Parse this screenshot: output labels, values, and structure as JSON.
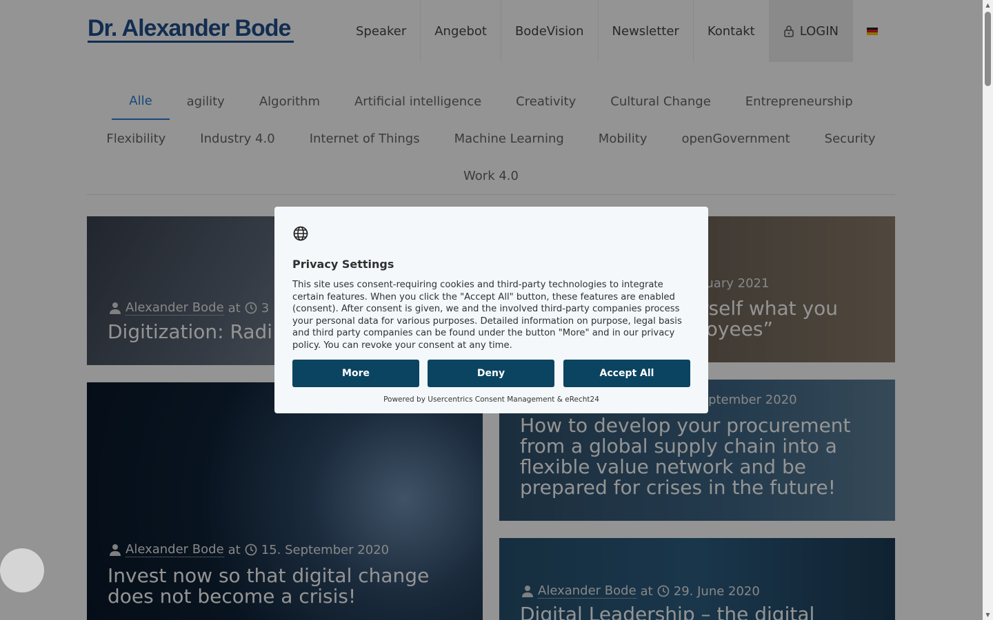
{
  "header": {
    "logo": "Dr. Alexander Bode",
    "nav": [
      "Speaker",
      "Angebot",
      "BodeVision",
      "Newsletter",
      "Kontakt"
    ],
    "login_label": "LOGIN",
    "language_flag": "de-flag-icon"
  },
  "categories": {
    "row1": [
      "Alle",
      "agility",
      "Algorithm",
      "Artificial intelligence",
      "Creativity",
      "Cultural Change",
      "Entrepreneurship"
    ],
    "row2": [
      "Flexibility",
      "Industry 4.0",
      "Internet of Things",
      "Machine Learning",
      "Mobility",
      "openGovernment",
      "Security"
    ],
    "row3": [
      "Work 4.0"
    ],
    "active": "Alle"
  },
  "posts": [
    {
      "author": "Alexander Bode",
      "at": "at",
      "date": "3",
      "title": "Digitization: Radi"
    },
    {
      "author": "",
      "at": "",
      "date": "ruary 2021",
      "title": "rself what you\nloyees”"
    },
    {
      "author": "Alexander Bode",
      "at": "at",
      "date": "15. September 2020",
      "title": "Invest now so that digital change does not become a crisis!"
    },
    {
      "author": "",
      "at": "",
      "date": "eptember 2020",
      "title": "How to develop your procurement from a global supply chain into a flexible value network and be prepared for crises in the future!"
    },
    {
      "author": "Alexander Bode",
      "at": "at",
      "date": "29. June 2020",
      "title": "Digital Leadership – the digital"
    }
  ],
  "privacy": {
    "title": "Privacy Settings",
    "text": "This site uses consent-requiring cookies and third-party technologies to integrate certain features. When you click the \"Accept All\" button, these features are enabled (consent). After consent is given, we and the involved third-party companies process your personal data for various purposes. Detailed information on purpose, legal basis and third party companies can be found under the button \"More\" and in our privacy policy. You can revoke your consent at any time.",
    "more_label": "More",
    "deny_label": "Deny",
    "accept_label": "Accept All",
    "powered_by": "Powered by Usercentrics Consent Management & eRecht24"
  },
  "colors": {
    "logo": "#1f4e8c",
    "active_category": "#2a7bd4",
    "button": "#0b4461"
  }
}
